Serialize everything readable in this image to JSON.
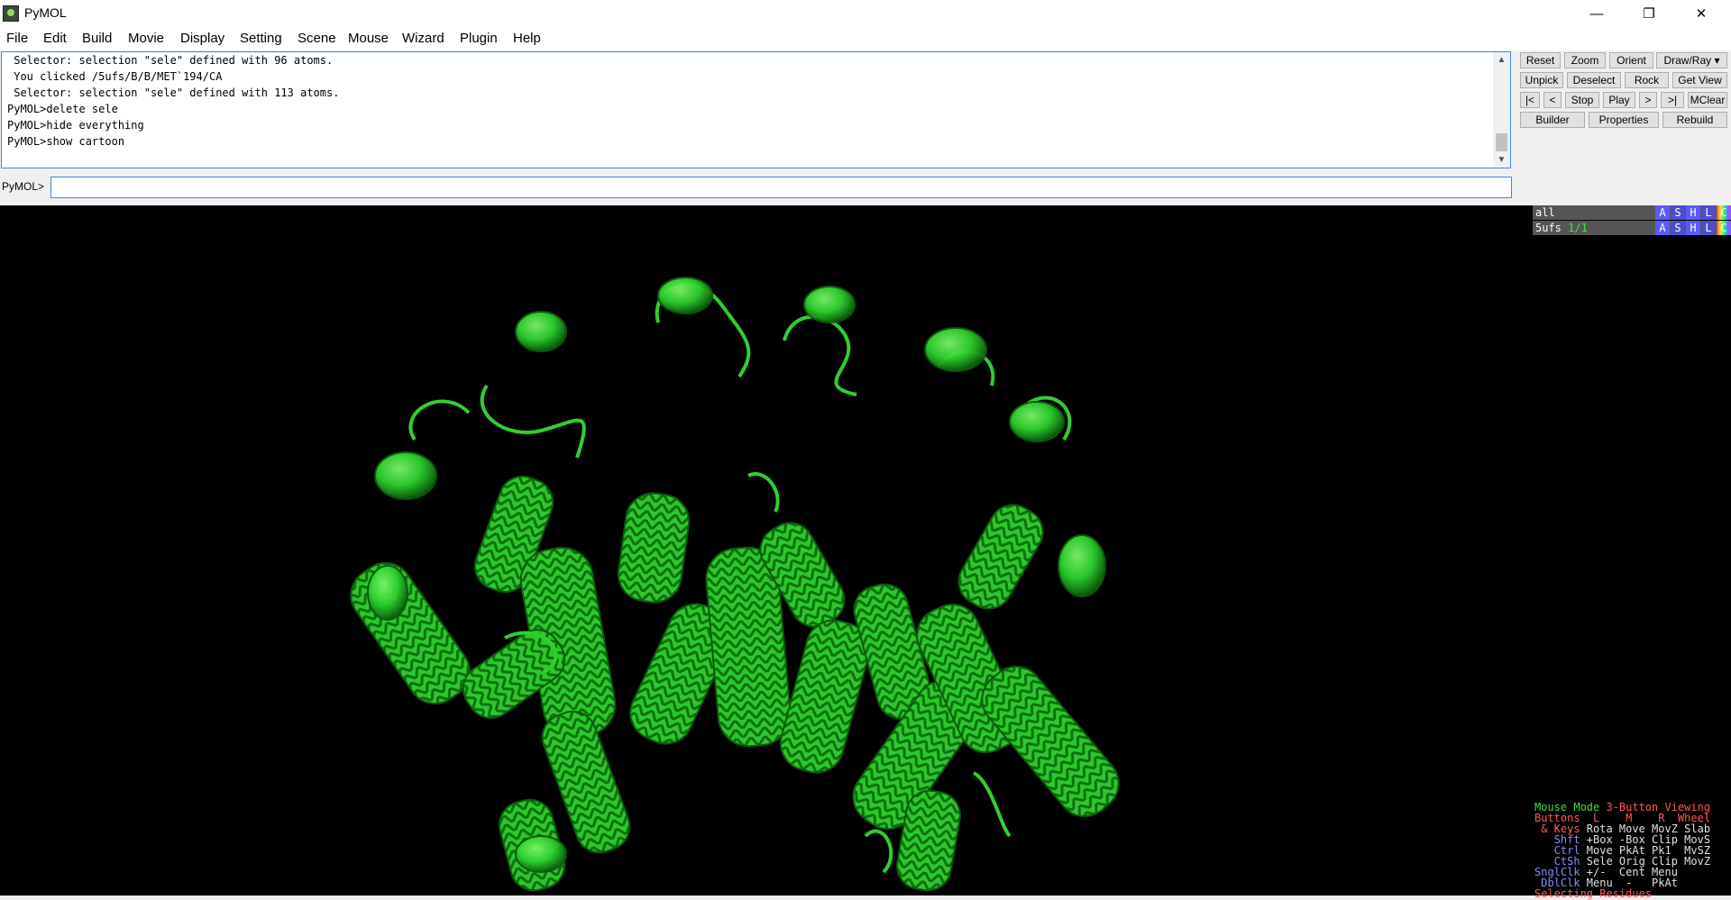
{
  "window": {
    "title": "PyMOL",
    "minimize": "—",
    "restore": "❐",
    "close": "✕"
  },
  "menu": [
    "File",
    "Edit",
    "Build",
    "Movie",
    "Display",
    "Setting",
    "Scene",
    "Mouse",
    "Wizard",
    "Plugin",
    "Help"
  ],
  "log": [
    " Selector: selection \"sele\" defined with 96 atoms.",
    " You clicked /5ufs/B/B/MET`194/CA",
    " Selector: selection \"sele\" defined with 113 atoms.",
    "PyMOL>delete sele",
    "PyMOL>hide everything",
    "PyMOL>show cartoon"
  ],
  "command": {
    "prompt": "PyMOL>",
    "value": ""
  },
  "buttons": {
    "row1": [
      "Reset",
      "Zoom",
      "Orient",
      "Draw/Ray ▾"
    ],
    "row2": [
      "Unpick",
      "Deselect",
      "Rock",
      "Get View"
    ],
    "row3": [
      "|<",
      "<",
      "Stop",
      "Play",
      ">",
      ">|",
      "MClear"
    ],
    "row4": [
      "Builder",
      "Properties",
      "Rebuild"
    ]
  },
  "objects": [
    {
      "name": "all",
      "state": ""
    },
    {
      "name": "5ufs",
      "state": "1/1"
    }
  ],
  "object_buttons": [
    "A",
    "S",
    "H",
    "L",
    "C"
  ],
  "colors": {
    "cartoon": "#2ed12e",
    "viewer_bg": "#000000",
    "accent": "#3d8bd9"
  },
  "mouse_panel": {
    "line1": {
      "a": "Mouse Mode ",
      "b": "3-Button Viewing"
    },
    "line2": {
      "a": "Buttons  L    M    R  Wheel"
    },
    "line3": {
      "a": " & Keys ",
      "b": "Rota Move MovZ Slab"
    },
    "line4": {
      "a": "   Shft ",
      "b": "+Box -Box Clip MovS"
    },
    "line5": {
      "a": "   Ctrl ",
      "b": "Move PkAt Pk1  MvSZ"
    },
    "line6": {
      "a": "   CtSh ",
      "b": "Sele Orig Clip MovZ"
    },
    "line7": {
      "a": "SnglClk ",
      "b": "+/-  Cent Menu"
    },
    "line8": {
      "a": " DblClk ",
      "b": "Menu  -   PkAt"
    },
    "line9": {
      "a": "Selecting Residues"
    }
  }
}
